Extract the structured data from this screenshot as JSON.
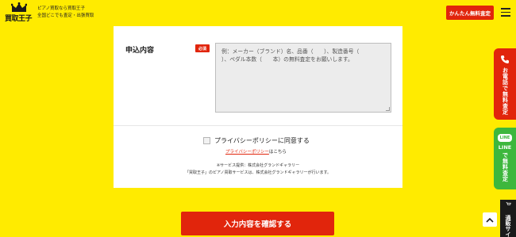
{
  "header": {
    "logo_text": "買取王子",
    "tagline_1": "ピアノ買取なら買取王子",
    "tagline_2": "全国どこでも査定・出張買取",
    "cta_label": "かんたん無料査定"
  },
  "form": {
    "field_label": "申込内容",
    "required_badge": "必須",
    "textarea_placeholder": "例：メーカー（ブランド）名、品番（　　）、製造番号（　　　　）、ペダル本数（　　本）の無料査定をお願いします。",
    "privacy_label": "プライバシーポリシーに同意する",
    "policy_link": "プライバシーポリシー",
    "policy_suffix": "はこちら",
    "note_1": "※サービス提供：株式会社グランドギャラリー",
    "note_2": "「買取王子」のピアノ買取サービスは、株式会社グランドギャラリーが行います。"
  },
  "confirm_label": "入力内容を確認する",
  "side": {
    "phone_label": "お電話で無料査定",
    "line_badge": "LINE",
    "line_word": "LINE",
    "line_label": "で無料査定",
    "store_label": "通販サイ"
  },
  "colors": {
    "brand_yellow": "#ffeb00",
    "accent_red": "#e1250c",
    "line_green": "#3db73d"
  }
}
